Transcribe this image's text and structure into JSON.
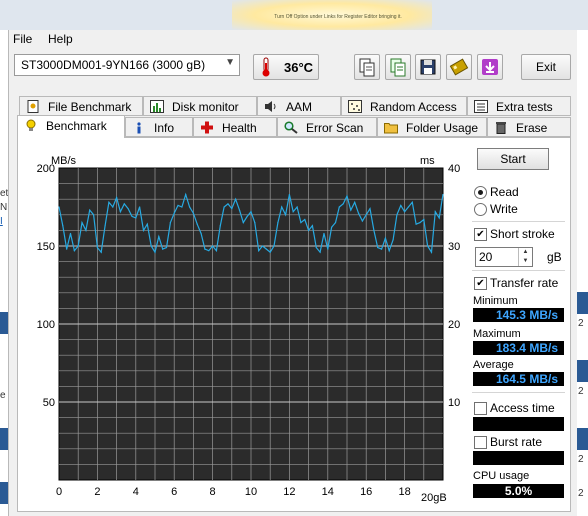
{
  "banner": {
    "text": "Turn Off Option under Links for Register Editor bringing it."
  },
  "menu": {
    "file": "File",
    "help": "Help"
  },
  "toolbar": {
    "drive": "ST3000DM001-9YN166 (3000 gB)",
    "temperature": "36°C",
    "exit_label": "Exit",
    "icons": [
      "copy-info-icon",
      "copy-text-icon",
      "save-icon",
      "screenshot-icon",
      "download-icon"
    ]
  },
  "tabs_top": [
    "File Benchmark",
    "Disk monitor",
    "AAM",
    "Random Access",
    "Extra tests"
  ],
  "tabs_bottom": [
    "Benchmark",
    "Info",
    "Health",
    "Error Scan",
    "Folder Usage",
    "Erase"
  ],
  "active_tab": "Benchmark",
  "controls": {
    "start_label": "Start",
    "read_label": "Read",
    "write_label": "Write",
    "mode_selected": "Read",
    "short_stroke_label": "Short stroke",
    "short_stroke_checked": true,
    "short_stroke_value": "20",
    "short_stroke_unit": "gB",
    "transfer_rate_label": "Transfer rate",
    "transfer_rate_checked": true,
    "minimum_label": "Minimum",
    "minimum_value": "145.3 MB/s",
    "maximum_label": "Maximum",
    "maximum_value": "183.4 MB/s",
    "average_label": "Average",
    "average_value": "164.5 MB/s",
    "access_time_label": "Access time",
    "access_time_checked": false,
    "burst_rate_label": "Burst rate",
    "burst_rate_checked": false,
    "cpu_usage_label": "CPU usage",
    "cpu_usage_value": "5.0%"
  },
  "colors": {
    "plot_bg": "#2b2b2b",
    "grid": "#9a9a9a",
    "line": "#27a9e1",
    "value_text": "#3ea6ff"
  },
  "chart_data": {
    "type": "line",
    "y_left_label": "MB/s",
    "y_right_label": "ms",
    "x_end_label": "20gB",
    "xlim": [
      0,
      20
    ],
    "ylim": [
      0,
      200
    ],
    "y2lim": [
      0,
      40
    ],
    "x_ticks": [
      "0",
      "2",
      "4",
      "6",
      "8",
      "10",
      "12",
      "14",
      "16",
      "18"
    ],
    "y_ticks": [
      "50",
      "100",
      "150",
      "200"
    ],
    "y2_ticks": [
      "10",
      "20",
      "30",
      "40"
    ],
    "grid": true,
    "series": [
      {
        "x": [
          0,
          0.2,
          0.4,
          0.6,
          0.8,
          1.0,
          1.2,
          1.4,
          1.6,
          1.8,
          2.0,
          2.2,
          2.4,
          2.6,
          2.8,
          3.0,
          3.2,
          3.4,
          3.6,
          3.8,
          4.0,
          4.2,
          4.4,
          4.6,
          4.8,
          5.0,
          5.2,
          5.4,
          5.6,
          5.8,
          6.0,
          6.2,
          6.4,
          6.6,
          6.8,
          7.0,
          7.2,
          7.4,
          7.6,
          7.8,
          8.0,
          8.2,
          8.4,
          8.6,
          8.8,
          9.0,
          9.2,
          9.4,
          9.6,
          9.8,
          10.0,
          10.2,
          10.4,
          10.6,
          10.8,
          11.0,
          11.2,
          11.4,
          11.6,
          11.8,
          12.0,
          12.2,
          12.4,
          12.6,
          12.8,
          13.0,
          13.2,
          13.4,
          13.6,
          13.8,
          14.0,
          14.2,
          14.4,
          14.6,
          14.8,
          15.0,
          15.2,
          15.4,
          15.6,
          15.8,
          16.0,
          16.2,
          16.4,
          16.6,
          16.8,
          17.0,
          17.2,
          17.4,
          17.6,
          17.8,
          18.0,
          18.2,
          18.4,
          18.6,
          18.8,
          19.0,
          19.2,
          19.4,
          19.6,
          19.8,
          20.0
        ],
        "values": [
          175,
          163,
          148,
          158,
          147,
          150,
          165,
          160,
          173,
          170,
          149,
          146,
          163,
          178,
          175,
          181,
          172,
          177,
          174,
          169,
          168,
          175,
          160,
          164,
          150,
          146,
          156,
          148,
          149,
          165,
          171,
          176,
          175,
          183,
          175,
          171,
          164,
          158,
          148,
          147,
          150,
          147,
          163,
          175,
          177,
          174,
          180,
          173,
          165,
          169,
          172,
          165,
          147,
          150,
          148,
          146,
          150,
          165,
          175,
          170,
          183,
          172,
          175,
          165,
          167,
          160,
          163,
          149,
          146,
          158,
          148,
          162,
          165,
          175,
          177,
          182,
          173,
          178,
          171,
          166,
          170,
          174,
          160,
          149,
          148,
          155,
          147,
          154,
          170,
          176,
          172,
          175,
          178,
          164,
          165,
          167,
          150,
          146,
          172,
          168,
          183
        ]
      }
    ]
  }
}
